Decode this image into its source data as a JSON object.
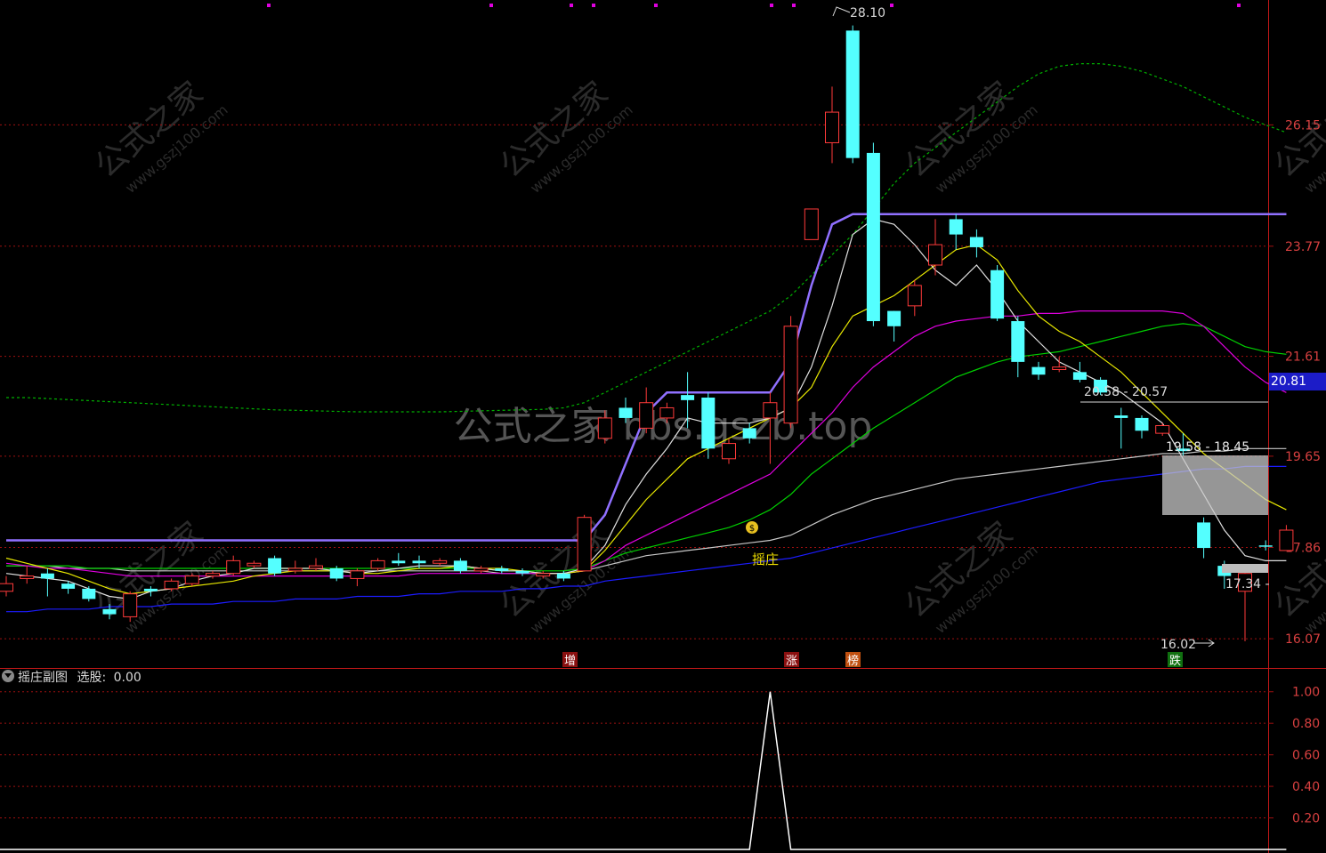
{
  "watermark": {
    "center_text": "公式之家 bbs.gszb.top",
    "tile_main": "公式之家",
    "tile_url": "www.gszj100.com"
  },
  "main_panel": {
    "y_ticks": [
      "26.15",
      "23.77",
      "21.61",
      "19.65",
      "17.86",
      "16.07"
    ],
    "current_price": "20.81",
    "annotations": {
      "high": "28.10",
      "low": "16.02",
      "range_a": "20.58 - 20.57",
      "range_b": "19.58 - 18.45",
      "level": "17.34 -"
    },
    "signal_label": "摇庄",
    "markers": [
      "增",
      "涨",
      "榜",
      "跌"
    ]
  },
  "sub_panel": {
    "title": "摇庄副图",
    "value_label": "选股:",
    "value": "0.00",
    "y_ticks": [
      "1.00",
      "0.80",
      "0.60",
      "0.40",
      "0.20"
    ]
  },
  "colors": {
    "background": "#000000",
    "grid": "#a01010",
    "up": "#ff3a3a",
    "down": "#54ffff",
    "ma_white": "#e0e0e0",
    "ma_yellow": "#e8e800",
    "ma_magenta": "#e000e0",
    "ma_green": "#00d000",
    "ma_blue": "#1c1cff",
    "ma_purple": "#9070ff",
    "band_green": "#00b000"
  },
  "chart_data": [
    {
      "type": "candlestick",
      "ylim": [
        15.6,
        28.6
      ],
      "candles": [
        {
          "o": 17.0,
          "c": 17.15,
          "h": 17.3,
          "l": 16.9
        },
        {
          "o": 17.25,
          "c": 17.3,
          "h": 17.5,
          "l": 17.15
        },
        {
          "o": 17.35,
          "c": 17.25,
          "h": 17.45,
          "l": 16.9
        },
        {
          "o": 17.15,
          "c": 17.05,
          "h": 17.2,
          "l": 16.95
        },
        {
          "o": 17.05,
          "c": 16.85,
          "h": 17.1,
          "l": 16.8
        },
        {
          "o": 16.65,
          "c": 16.55,
          "h": 16.75,
          "l": 16.45
        },
        {
          "o": 16.5,
          "c": 16.95,
          "h": 17.0,
          "l": 16.4
        },
        {
          "o": 17.05,
          "c": 17.0,
          "h": 17.1,
          "l": 16.9
        },
        {
          "o": 17.05,
          "c": 17.2,
          "h": 17.25,
          "l": 17.0
        },
        {
          "o": 17.15,
          "c": 17.3,
          "h": 17.35,
          "l": 17.1
        },
        {
          "o": 17.3,
          "c": 17.35,
          "h": 17.4,
          "l": 17.25
        },
        {
          "o": 17.35,
          "c": 17.6,
          "h": 17.7,
          "l": 17.3
        },
        {
          "o": 17.5,
          "c": 17.55,
          "h": 17.6,
          "l": 17.45
        },
        {
          "o": 17.65,
          "c": 17.35,
          "h": 17.7,
          "l": 17.3
        },
        {
          "o": 17.4,
          "c": 17.45,
          "h": 17.6,
          "l": 17.35
        },
        {
          "o": 17.45,
          "c": 17.5,
          "h": 17.65,
          "l": 17.4
        },
        {
          "o": 17.45,
          "c": 17.25,
          "h": 17.5,
          "l": 17.2
        },
        {
          "o": 17.25,
          "c": 17.4,
          "h": 17.45,
          "l": 17.1
        },
        {
          "o": 17.45,
          "c": 17.6,
          "h": 17.65,
          "l": 17.4
        },
        {
          "o": 17.6,
          "c": 17.55,
          "h": 17.75,
          "l": 17.5
        },
        {
          "o": 17.6,
          "c": 17.55,
          "h": 17.7,
          "l": 17.45
        },
        {
          "o": 17.55,
          "c": 17.6,
          "h": 17.65,
          "l": 17.5
        },
        {
          "o": 17.6,
          "c": 17.4,
          "h": 17.65,
          "l": 17.35
        },
        {
          "o": 17.4,
          "c": 17.45,
          "h": 17.5,
          "l": 17.35
        },
        {
          "o": 17.45,
          "c": 17.4,
          "h": 17.5,
          "l": 17.35
        },
        {
          "o": 17.4,
          "c": 17.35,
          "h": 17.45,
          "l": 17.3
        },
        {
          "o": 17.3,
          "c": 17.35,
          "h": 17.4,
          "l": 17.25
        },
        {
          "o": 17.35,
          "c": 17.25,
          "h": 17.4,
          "l": 17.2
        },
        {
          "o": 17.4,
          "c": 18.45,
          "h": 18.5,
          "l": 17.4
        },
        {
          "o": 20.0,
          "c": 20.4,
          "h": 20.55,
          "l": 19.9
        },
        {
          "o": 20.6,
          "c": 20.4,
          "h": 20.8,
          "l": 20.3
        },
        {
          "o": 20.2,
          "c": 20.7,
          "h": 21.0,
          "l": 20.1
        },
        {
          "o": 20.4,
          "c": 20.6,
          "h": 20.7,
          "l": 20.3
        },
        {
          "o": 20.85,
          "c": 20.75,
          "h": 21.3,
          "l": 20.2
        },
        {
          "o": 20.8,
          "c": 19.8,
          "h": 20.9,
          "l": 19.6
        },
        {
          "o": 19.6,
          "c": 19.9,
          "h": 20.0,
          "l": 19.5
        },
        {
          "o": 20.2,
          "c": 20.0,
          "h": 20.3,
          "l": 19.9
        },
        {
          "o": 20.4,
          "c": 20.7,
          "h": 20.9,
          "l": 19.5
        },
        {
          "o": 20.3,
          "c": 22.2,
          "h": 22.4,
          "l": 20.2
        },
        {
          "o": 23.9,
          "c": 24.5,
          "h": 24.5,
          "l": 23.9
        },
        {
          "o": 25.8,
          "c": 26.4,
          "h": 26.9,
          "l": 25.4
        },
        {
          "o": 28.0,
          "c": 25.5,
          "h": 28.1,
          "l": 25.4
        },
        {
          "o": 25.6,
          "c": 22.3,
          "h": 25.8,
          "l": 22.2
        },
        {
          "o": 22.5,
          "c": 22.2,
          "h": 22.5,
          "l": 21.9
        },
        {
          "o": 22.6,
          "c": 23.0,
          "h": 23.1,
          "l": 22.4
        },
        {
          "o": 23.4,
          "c": 23.8,
          "h": 24.3,
          "l": 23.2
        },
        {
          "o": 24.3,
          "c": 24.0,
          "h": 24.4,
          "l": 23.7
        },
        {
          "o": 23.95,
          "c": 23.75,
          "h": 24.1,
          "l": 23.55
        },
        {
          "o": 23.3,
          "c": 22.35,
          "h": 23.4,
          "l": 22.3
        },
        {
          "o": 22.3,
          "c": 21.5,
          "h": 22.4,
          "l": 21.2
        },
        {
          "o": 21.4,
          "c": 21.25,
          "h": 21.5,
          "l": 21.15
        },
        {
          "o": 21.35,
          "c": 21.4,
          "h": 21.6,
          "l": 21.3
        },
        {
          "o": 21.3,
          "c": 21.15,
          "h": 21.5,
          "l": 21.1
        },
        {
          "o": 21.15,
          "c": 20.9,
          "h": 21.2,
          "l": 20.85
        },
        {
          "o": 20.45,
          "c": 20.4,
          "h": 20.6,
          "l": 19.8
        },
        {
          "o": 20.4,
          "c": 20.15,
          "h": 20.45,
          "l": 20.0
        },
        {
          "o": 20.1,
          "c": 20.25,
          "h": 20.3,
          "l": 20.05
        },
        {
          "o": 19.8,
          "c": 19.75,
          "h": 20.1,
          "l": 19.65
        },
        {
          "o": 18.35,
          "c": 17.85,
          "h": 18.45,
          "l": 17.65
        },
        {
          "o": 17.5,
          "c": 17.3,
          "h": 17.6,
          "l": 17.05
        },
        {
          "o": 17.0,
          "c": 17.35,
          "h": 17.4,
          "l": 16.02
        },
        {
          "o": 17.9,
          "c": 17.88,
          "h": 18.0,
          "l": 17.8
        },
        {
          "o": 17.8,
          "c": 18.2,
          "h": 18.3,
          "l": 17.8
        }
      ],
      "overlay_lines": {
        "white": [
          17.35,
          17.3,
          17.25,
          17.2,
          17.05,
          16.9,
          16.85,
          17.0,
          17.05,
          17.2,
          17.3,
          17.35,
          17.45,
          17.45,
          17.45,
          17.45,
          17.4,
          17.35,
          17.4,
          17.45,
          17.5,
          17.5,
          17.5,
          17.45,
          17.4,
          17.4,
          17.35,
          17.35,
          17.45,
          17.9,
          18.7,
          19.3,
          19.8,
          20.4,
          20.3,
          20.3,
          20.3,
          20.4,
          20.6,
          21.4,
          22.6,
          24.0,
          24.3,
          24.2,
          23.8,
          23.3,
          23.0,
          23.4,
          22.9,
          22.3,
          21.9,
          21.5,
          21.3,
          21.1,
          20.9,
          20.6,
          20.3,
          19.6,
          18.9,
          18.2,
          17.7,
          17.6,
          17.6
        ],
        "yellow": [
          17.65,
          17.55,
          17.45,
          17.35,
          17.2,
          17.05,
          16.95,
          17.0,
          17.05,
          17.1,
          17.15,
          17.2,
          17.3,
          17.35,
          17.4,
          17.4,
          17.4,
          17.35,
          17.35,
          17.4,
          17.45,
          17.45,
          17.5,
          17.45,
          17.45,
          17.4,
          17.35,
          17.35,
          17.4,
          17.8,
          18.3,
          18.8,
          19.2,
          19.6,
          19.8,
          20.0,
          20.2,
          20.4,
          20.6,
          21.0,
          21.8,
          22.4,
          22.6,
          22.8,
          23.1,
          23.4,
          23.7,
          23.8,
          23.5,
          22.9,
          22.4,
          22.1,
          21.9,
          21.6,
          21.3,
          20.9,
          20.5,
          20.1,
          19.7,
          19.4,
          19.1,
          18.8,
          18.6
        ],
        "magenta": [
          17.55,
          17.5,
          17.45,
          17.45,
          17.4,
          17.35,
          17.3,
          17.3,
          17.3,
          17.3,
          17.3,
          17.3,
          17.3,
          17.3,
          17.3,
          17.3,
          17.3,
          17.3,
          17.3,
          17.3,
          17.35,
          17.35,
          17.35,
          17.35,
          17.35,
          17.35,
          17.35,
          17.35,
          17.4,
          17.6,
          17.9,
          18.1,
          18.3,
          18.5,
          18.7,
          18.9,
          19.1,
          19.3,
          19.7,
          20.1,
          20.5,
          21.0,
          21.4,
          21.7,
          22.0,
          22.2,
          22.3,
          22.35,
          22.4,
          22.4,
          22.45,
          22.45,
          22.5,
          22.5,
          22.5,
          22.5,
          22.5,
          22.45,
          22.2,
          21.8,
          21.4,
          21.1,
          20.9
        ],
        "green": [
          17.5,
          17.5,
          17.5,
          17.5,
          17.45,
          17.45,
          17.45,
          17.45,
          17.45,
          17.45,
          17.45,
          17.45,
          17.45,
          17.45,
          17.45,
          17.45,
          17.45,
          17.45,
          17.45,
          17.45,
          17.45,
          17.45,
          17.45,
          17.45,
          17.4,
          17.4,
          17.4,
          17.4,
          17.45,
          17.6,
          17.75,
          17.85,
          17.95,
          18.05,
          18.15,
          18.25,
          18.4,
          18.6,
          18.9,
          19.3,
          19.6,
          19.9,
          20.2,
          20.45,
          20.7,
          20.95,
          21.2,
          21.35,
          21.5,
          21.6,
          21.65,
          21.7,
          21.8,
          21.9,
          22.0,
          22.1,
          22.2,
          22.25,
          22.2,
          22.0,
          21.8,
          21.7,
          21.65
        ],
        "ma_white_slow": [
          17.5,
          17.5,
          17.5,
          17.45,
          17.45,
          17.45,
          17.4,
          17.4,
          17.4,
          17.4,
          17.4,
          17.4,
          17.4,
          17.4,
          17.4,
          17.4,
          17.4,
          17.4,
          17.4,
          17.4,
          17.4,
          17.4,
          17.4,
          17.4,
          17.35,
          17.35,
          17.35,
          17.35,
          17.4,
          17.5,
          17.6,
          17.7,
          17.75,
          17.8,
          17.85,
          17.9,
          17.95,
          18.0,
          18.1,
          18.3,
          18.5,
          18.65,
          18.8,
          18.9,
          19.0,
          19.1,
          19.2,
          19.25,
          19.3,
          19.35,
          19.4,
          19.45,
          19.5,
          19.55,
          19.6,
          19.65,
          19.7,
          19.7,
          19.75,
          19.75,
          19.8,
          19.8,
          19.8
        ],
        "blue": [
          16.6,
          16.6,
          16.65,
          16.65,
          16.65,
          16.7,
          16.7,
          16.7,
          16.75,
          16.75,
          16.75,
          16.8,
          16.8,
          16.8,
          16.85,
          16.85,
          16.85,
          16.9,
          16.9,
          16.9,
          16.95,
          16.95,
          17.0,
          17.0,
          17.0,
          17.05,
          17.05,
          17.1,
          17.1,
          17.2,
          17.25,
          17.3,
          17.35,
          17.4,
          17.45,
          17.5,
          17.55,
          17.6,
          17.65,
          17.75,
          17.85,
          17.95,
          18.05,
          18.15,
          18.25,
          18.35,
          18.45,
          18.55,
          18.65,
          18.75,
          18.85,
          18.95,
          19.05,
          19.15,
          19.2,
          19.25,
          19.3,
          19.35,
          19.4,
          19.4,
          19.45,
          19.45,
          19.45
        ],
        "purple_step": [
          18.0,
          18.0,
          18.0,
          18.0,
          18.0,
          18.0,
          18.0,
          18.0,
          18.0,
          18.0,
          18.0,
          18.0,
          18.0,
          18.0,
          18.0,
          18.0,
          18.0,
          18.0,
          18.0,
          18.0,
          18.0,
          18.0,
          18.0,
          18.0,
          18.0,
          18.0,
          18.0,
          18.0,
          18.0,
          18.5,
          19.5,
          20.5,
          20.9,
          20.9,
          20.9,
          20.9,
          20.9,
          20.9,
          21.5,
          23.0,
          24.2,
          24.4,
          24.4,
          24.4,
          24.4,
          24.4,
          24.4,
          24.4,
          24.4,
          24.4,
          24.4,
          24.4,
          24.4,
          24.4,
          24.4,
          24.4,
          24.4,
          24.4,
          24.4,
          24.4,
          24.4,
          24.4,
          24.4
        ],
        "green_band": [
          20.8,
          20.8,
          20.78,
          20.76,
          20.74,
          20.72,
          20.7,
          20.68,
          20.66,
          20.64,
          20.62,
          20.6,
          20.58,
          20.56,
          20.55,
          20.54,
          20.53,
          20.52,
          20.52,
          20.52,
          20.52,
          20.52,
          20.53,
          20.54,
          20.55,
          20.56,
          20.57,
          20.6,
          20.7,
          20.9,
          21.1,
          21.3,
          21.5,
          21.7,
          21.9,
          22.1,
          22.3,
          22.5,
          22.8,
          23.2,
          23.6,
          24.0,
          24.5,
          25.0,
          25.4,
          25.7,
          26.0,
          26.3,
          26.6,
          26.9,
          27.15,
          27.3,
          27.35,
          27.35,
          27.3,
          27.2,
          27.05,
          26.9,
          26.7,
          26.5,
          26.3,
          26.15,
          26.0
        ]
      }
    },
    {
      "type": "line",
      "title": "摇庄副图",
      "ylim": [
        0,
        1.1
      ],
      "values": [
        0,
        0,
        0,
        0,
        0,
        0,
        0,
        0,
        0,
        0,
        0,
        0,
        0,
        0,
        0,
        0,
        0,
        0,
        0,
        0,
        0,
        0,
        0,
        0,
        0,
        0,
        0,
        0,
        0,
        0,
        0,
        0,
        0,
        0,
        0,
        0,
        0,
        1,
        0,
        0,
        0,
        0,
        0,
        0,
        0,
        0,
        0,
        0,
        0,
        0,
        0,
        0,
        0,
        0,
        0,
        0,
        0,
        0,
        0,
        0,
        0,
        0,
        0
      ]
    }
  ]
}
